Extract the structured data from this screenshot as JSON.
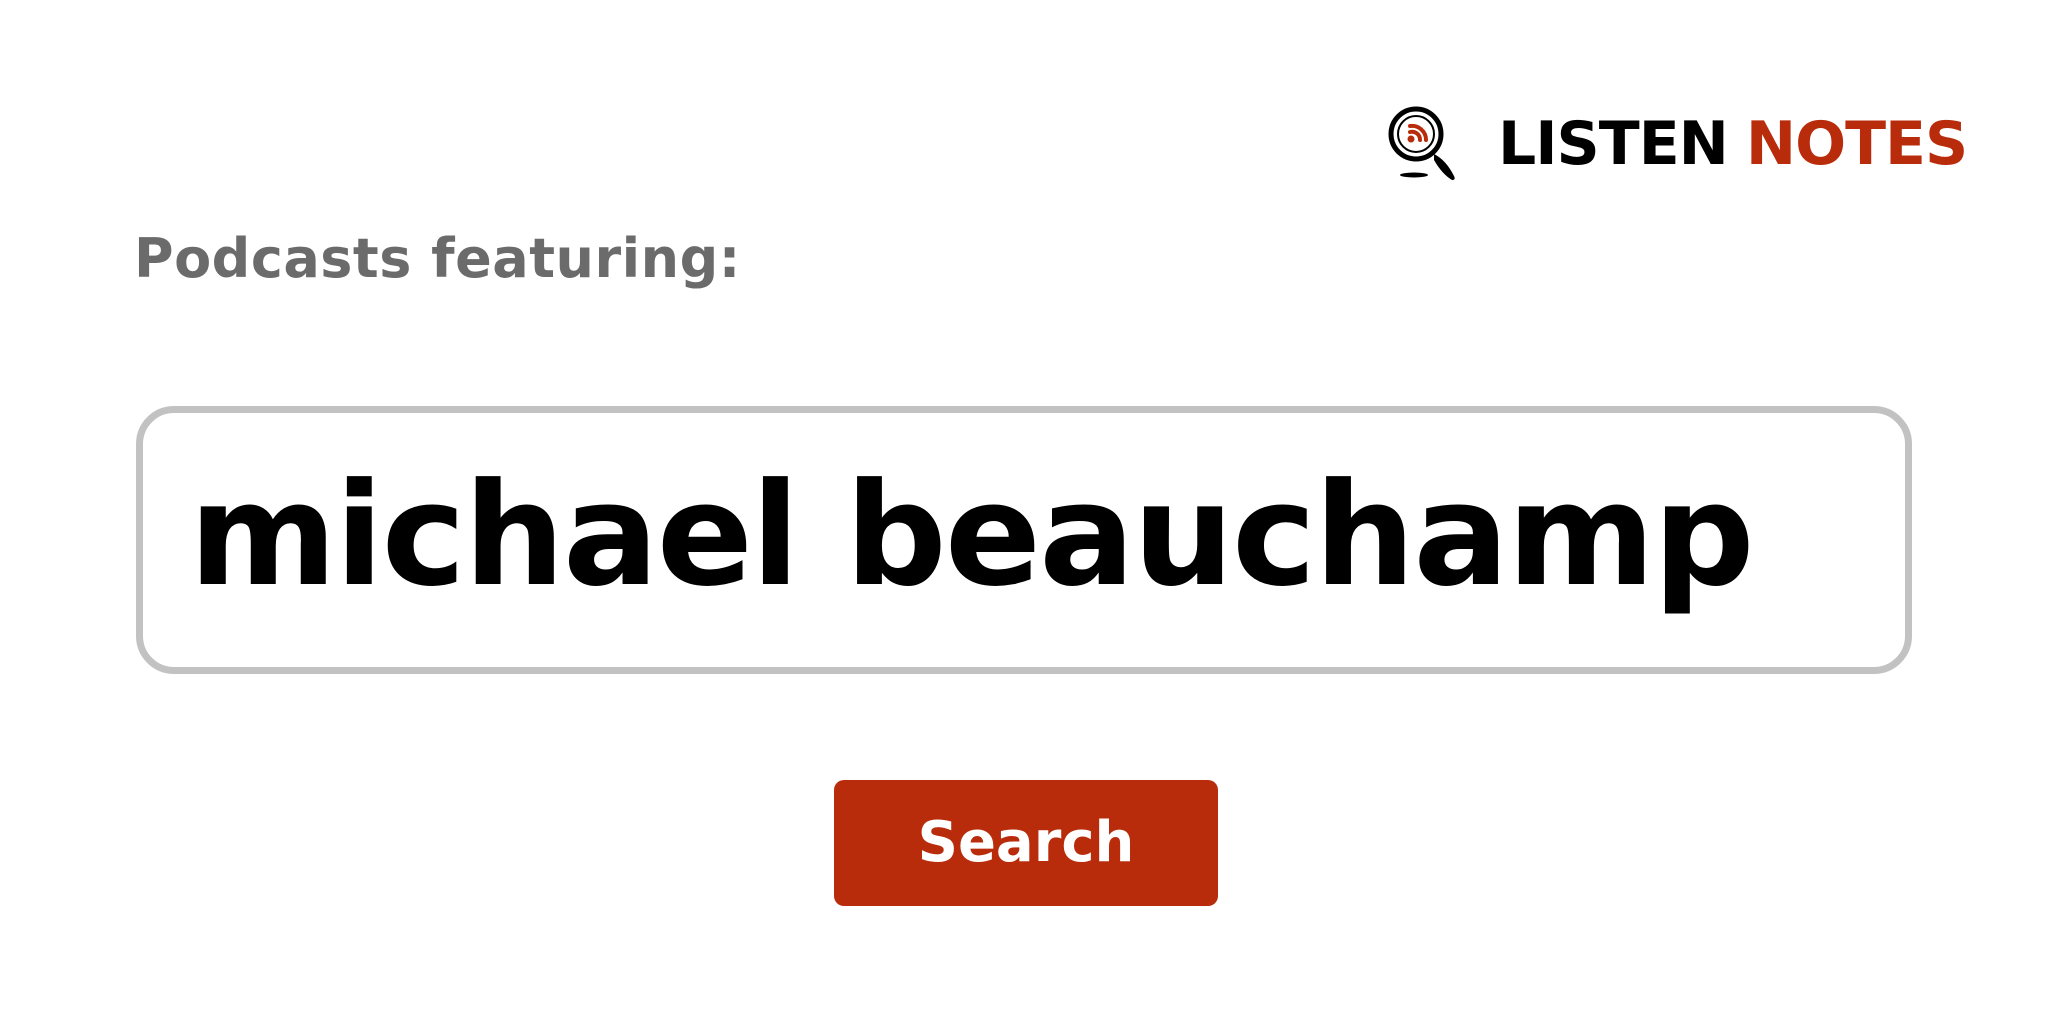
{
  "logo": {
    "icon": "podcast-magnifier-icon",
    "word1": "LISTEN",
    "word2": "NOTES",
    "colors": {
      "dark": "#000000",
      "accent": "#b92c0b"
    }
  },
  "heading": "Podcasts featuring:",
  "search": {
    "value": "michael beauchamp"
  },
  "button": {
    "label": "Search",
    "color": "#b92c0b"
  }
}
